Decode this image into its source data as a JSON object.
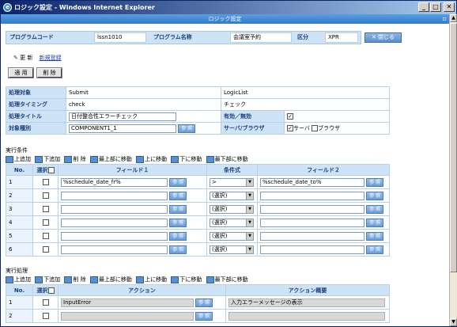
{
  "window": {
    "title": "ロジック設定 - Windows Internet Explorer",
    "icon": "ie-icon"
  },
  "page": {
    "heading": "ロジック設定"
  },
  "program": {
    "code_label": "プログラムコード",
    "code_value": "lssn1010",
    "name_label": "プログラム名称",
    "name_value": "会議室予約",
    "kubun_label": "区分",
    "kubun_value": "XPR",
    "close_label": "✕ 閉じる"
  },
  "mode": {
    "edit_label": "更 新",
    "new_link": "新規登録"
  },
  "buttons": {
    "apply": "適 用",
    "delete": "削 除",
    "ref": "参 照"
  },
  "form": {
    "target_label": "処理対象",
    "target_value": "Submit",
    "target_value2": "LogicList",
    "timing_label": "処理タイミング",
    "timing_value": "check",
    "timing_value2": "チェック",
    "title_label": "処理タイトル",
    "title_value": "日付整合性エラーチェック",
    "valid_label": "有効／無効",
    "kind_label": "対象種別",
    "kind_value": "COMPONENT1_1",
    "server_label": "サーバ/ブラウザ",
    "server_opt": "サーバ",
    "browser_opt": "ブラウザ"
  },
  "cond": {
    "section": "実行条件",
    "toolbar": [
      "上追加",
      "下追加",
      "削 除",
      "最上部に移動",
      "上に移動",
      "下に移動",
      "最下部に移動"
    ],
    "headers": {
      "no": "No.",
      "select": "選択",
      "field1": "フィールド１",
      "op": "条件式",
      "field2": "フィールド２"
    },
    "rows": [
      {
        "no": "1",
        "f1": "%schedule_date_fr%",
        "op": ">",
        "f2": "%schedule_date_to%"
      },
      {
        "no": "2",
        "f1": "",
        "op": "(選択)",
        "f2": ""
      },
      {
        "no": "3",
        "f1": "",
        "op": "(選択)",
        "f2": ""
      },
      {
        "no": "4",
        "f1": "",
        "op": "(選択)",
        "f2": ""
      },
      {
        "no": "5",
        "f1": "",
        "op": "(選択)",
        "f2": ""
      },
      {
        "no": "6",
        "f1": "",
        "op": "(選択)",
        "f2": ""
      }
    ]
  },
  "exec": {
    "section": "実行処理",
    "toolbar": [
      "上追加",
      "下追加",
      "削 除",
      "最上部に移動",
      "上に移動",
      "下に移動",
      "最下部に移動"
    ],
    "headers": {
      "no": "No.",
      "select": "選択",
      "action": "アクション",
      "summary": "アクション概要"
    },
    "rows": [
      {
        "no": "1",
        "action": "InputError",
        "summary": "入力エラーメッセージの表示"
      },
      {
        "no": "2",
        "action": "",
        "summary": ""
      }
    ]
  }
}
